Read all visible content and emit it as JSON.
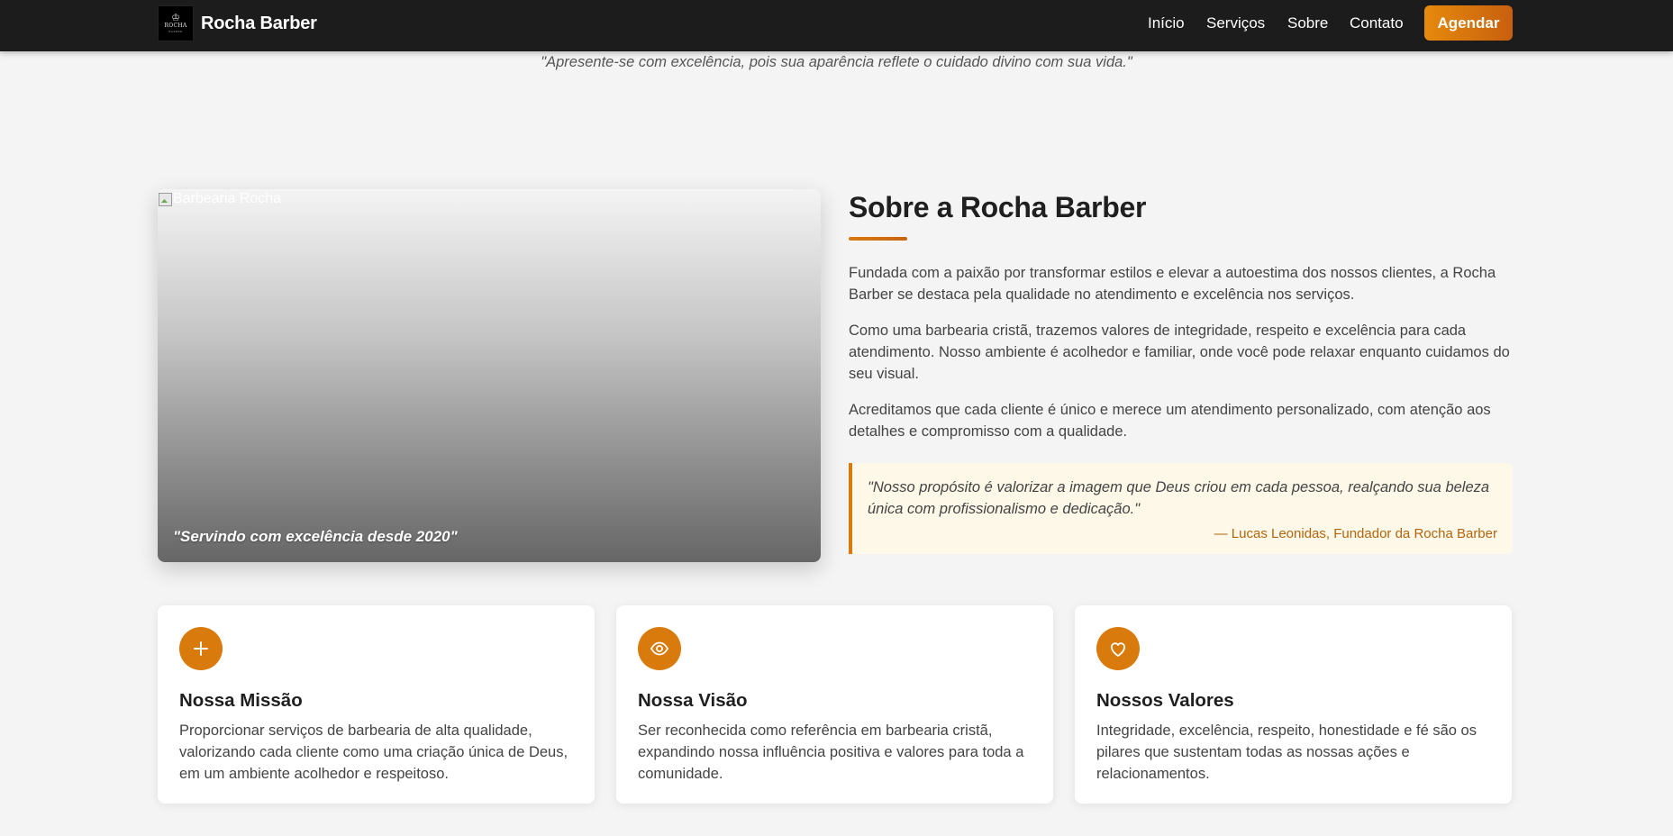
{
  "brand": {
    "name": "Rocha Barber",
    "logo_text": "ROCHA",
    "logo_sub": "BARBER"
  },
  "nav": {
    "items": [
      {
        "label": "Início"
      },
      {
        "label": "Serviços"
      },
      {
        "label": "Sobre"
      },
      {
        "label": "Contato"
      }
    ],
    "cta_label": "Agendar"
  },
  "top_quote": "\"Apresente-se com excelência, pois sua aparência reflete o cuidado divino com sua vida.\"",
  "image_panel": {
    "alt_text": "Barbearia Rocha",
    "caption": "\"Servindo com excelência desde 2020\""
  },
  "about": {
    "title": "Sobre a Rocha Barber",
    "paragraphs": [
      "Fundada com a paixão por transformar estilos e elevar a autoestima dos nossos clientes, a Rocha Barber se destaca pela qualidade no atendimento e excelência nos serviços.",
      "Como uma barbearia cristã, trazemos valores de integridade, respeito e excelência para cada atendimento. Nosso ambiente é acolhedor e familiar, onde você pode relaxar enquanto cuidamos do seu visual.",
      "Acreditamos que cada cliente é único e merece um atendimento personalizado, com atenção aos detalhes e compromisso com a qualidade."
    ],
    "quote": {
      "text": "\"Nosso propósito é valorizar a imagem que Deus criou em cada pessoa, realçando sua beleza única com profissionalismo e dedicação.\"",
      "author": "— Lucas Leonidas, Fundador da Rocha Barber"
    }
  },
  "cards": [
    {
      "icon": "plus-icon",
      "title": "Nossa Missão",
      "text": "Proporcionar serviços de barbearia de alta qualidade, valorizando cada cliente como uma criação única de Deus, em um ambiente acolhedor e respeitoso."
    },
    {
      "icon": "eye-icon",
      "title": "Nossa Visão",
      "text": "Ser reconhecida como referência em barbearia cristã, expandindo nossa influência positiva e valores para toda a comunidade."
    },
    {
      "icon": "heart-icon",
      "title": "Nossos Valores",
      "text": "Integridade, excelência, respeito, honestidade e fé são os pilares que sustentam todas as nossas ações e relacionamentos."
    }
  ],
  "colors": {
    "navbar_bg": "#1c1c1c",
    "accent": "#d97a0c",
    "page_bg": "#f4f4f4",
    "quote_bg": "#fdf8e8"
  }
}
